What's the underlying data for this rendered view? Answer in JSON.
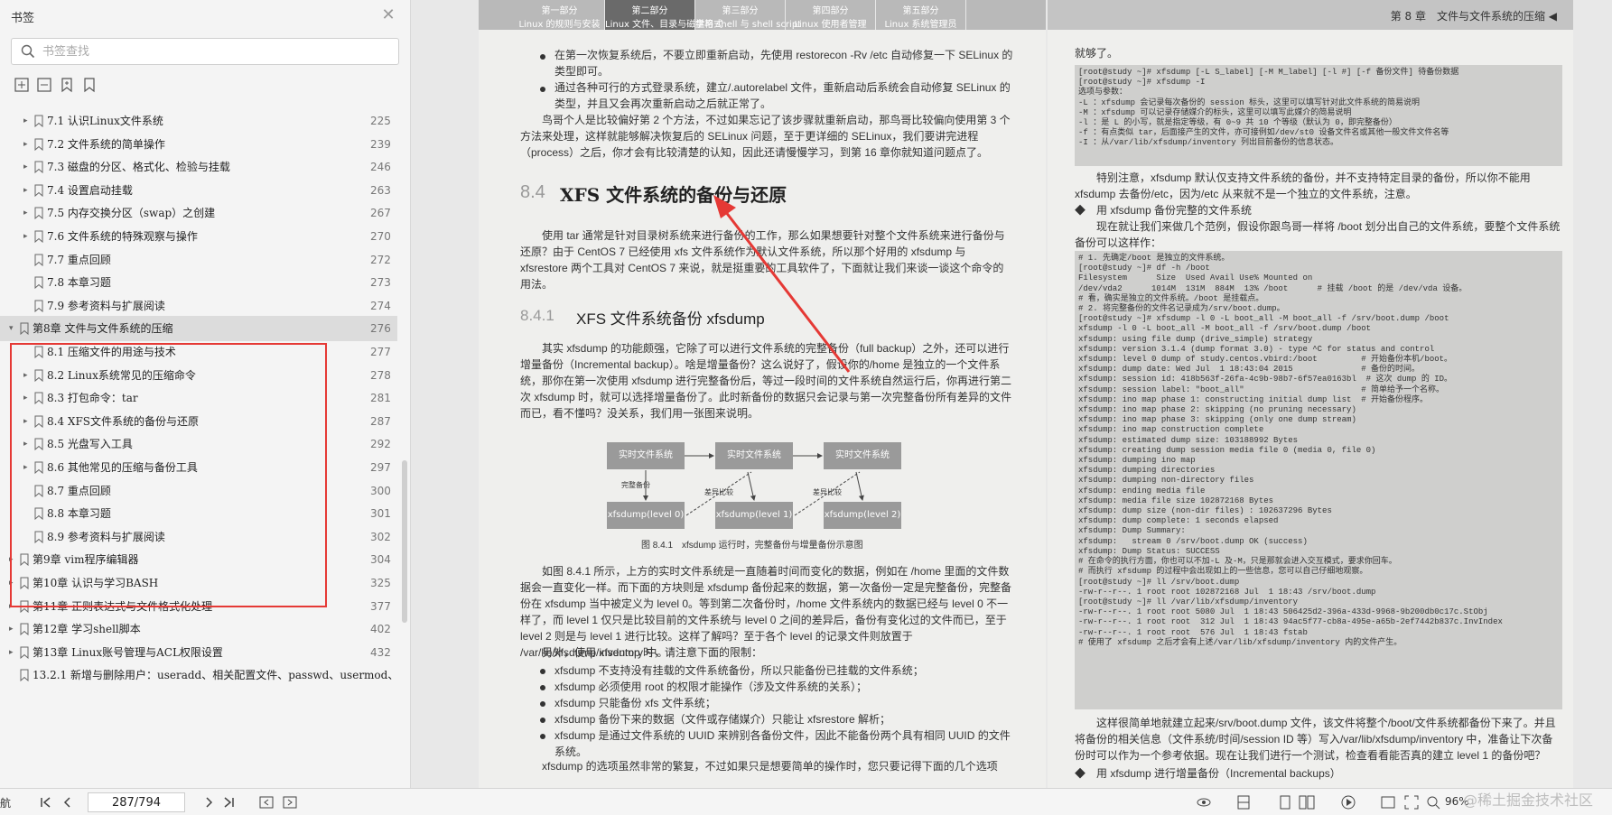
{
  "sidebar": {
    "title": "书签",
    "search_placeholder": "书签查找",
    "close_glyph": "✕",
    "bookmarks": [
      {
        "label": "7.1 认识Linux文件系统",
        "page": "225",
        "level": 2,
        "expandable": true
      },
      {
        "label": "7.2 文件系统的简单操作",
        "page": "239",
        "level": 2,
        "expandable": true
      },
      {
        "label": "7.3 磁盘的分区、格式化、检验与挂载",
        "page": "246",
        "level": 2,
        "expandable": true
      },
      {
        "label": "7.4 设置启动挂载",
        "page": "263",
        "level": 2,
        "expandable": true
      },
      {
        "label": "7.5 内存交换分区（swap）之创建",
        "page": "267",
        "level": 2,
        "expandable": true
      },
      {
        "label": "7.6 文件系统的特殊观察与操作",
        "page": "270",
        "level": 2,
        "expandable": true
      },
      {
        "label": "7.7 重点回顾",
        "page": "272",
        "level": 2,
        "expandable": false
      },
      {
        "label": "7.8 本章习题",
        "page": "273",
        "level": 2,
        "expandable": false
      },
      {
        "label": "7.9 参考资料与扩展阅读",
        "page": "274",
        "level": 2,
        "expandable": false
      },
      {
        "label": "第8章 文件与文件系统的压缩",
        "page": "276",
        "level": 1,
        "expandable": true,
        "expanded": true
      },
      {
        "label": "8.1 压缩文件的用途与技术",
        "page": "277",
        "level": 2,
        "expandable": false
      },
      {
        "label": "8.2 Linux系统常见的压缩命令",
        "page": "278",
        "level": 2,
        "expandable": true
      },
      {
        "label": "8.3 打包命令：tar",
        "page": "281",
        "level": 2,
        "expandable": true
      },
      {
        "label": "8.4 XFS文件系统的备份与还原",
        "page": "287",
        "level": 2,
        "expandable": true
      },
      {
        "label": "8.5 光盘写入工具",
        "page": "292",
        "level": 2,
        "expandable": true
      },
      {
        "label": "8.6 其他常见的压缩与备份工具",
        "page": "297",
        "level": 2,
        "expandable": true
      },
      {
        "label": "8.7 重点回顾",
        "page": "300",
        "level": 2,
        "expandable": false
      },
      {
        "label": "8.8 本章习题",
        "page": "301",
        "level": 2,
        "expandable": false
      },
      {
        "label": "8.9 参考资料与扩展阅读",
        "page": "302",
        "level": 2,
        "expandable": false
      },
      {
        "label": "第9章 vim程序编辑器",
        "page": "304",
        "level": 1,
        "expandable": true
      },
      {
        "label": "第10章 认识与学习BASH",
        "page": "325",
        "level": 1,
        "expandable": true
      },
      {
        "label": "第11章 正则表达式与文件格式化处理",
        "page": "377",
        "level": 1,
        "expandable": true
      },
      {
        "label": "第12章 学习shell脚本",
        "page": "402",
        "level": 1,
        "expandable": true
      },
      {
        "label": "第13章 Linux账号管理与ACL权限设置",
        "page": "432",
        "level": 1,
        "expandable": true
      },
      {
        "label": "13.2.1 新增与删除用户：useradd、相关配置文件、passwd、usermod、",
        "page": "",
        "level": 1,
        "expandable": false
      }
    ]
  },
  "document": {
    "tabs": [
      {
        "line1": "第一部分",
        "line2": "Linux 的规则与安装",
        "active": false
      },
      {
        "line1": "第二部分",
        "line2": "Linux 文件、目录与磁盘格式",
        "active": true
      },
      {
        "line1": "第三部分",
        "line2": "学习 shell 与 shell script",
        "active": false
      },
      {
        "line1": "第四部分",
        "line2": "Linux 使用者管理",
        "active": false
      },
      {
        "line1": "第五部分",
        "line2": "Linux 系统管理员",
        "active": false
      }
    ],
    "chapter_header": "第 8 章　文件与文件系统的压缩 ◀",
    "left": {
      "bullets_top": [
        "在第一次恢复系统后，不要立即重新启动，先使用 restorecon -Rv /etc 自动修复一下 SELinux 的类型即可。",
        "通过各种可行的方式登录系统，建立/.autorelabel 文件，重新启动后系统会自动修复 SELinux 的类型，并且又会再次重新启动之后就正常了。"
      ],
      "para_intro": "鸟哥个人是比较偏好第 2 个方法，不过如果忘记了该步骤就重新启动，那鸟哥比较偏向使用第 3 个方法来处理，这样就能够解决恢复后的 SELinux 问题，至于更详细的 SELinux，我们要讲完进程（process）之后，你才会有比较清楚的认知，因此还请慢慢学习，到第 16 章你就知道问题点了。",
      "sec_num": "8.4",
      "sec_title": "XFS 文件系统的备份与还原",
      "para_sec": "使用 tar 通常是针对目录树系统来进行备份的工作，那么如果想要针对整个文件系统来进行备份与还原？由于 CentOS 7 已经使用 xfs 文件系统作为默认文件系统，所以那个好用的 xfsdump 与 xfsrestore 两个工具对 CentOS 7 来说，就是挺重要的工具软件了，下面就让我们来谈一谈这个命令的用法。",
      "sub_num": "8.4.1",
      "sub_title": "XFS 文件系统备份 xfsdump",
      "para_sub": "其实 xfsdump 的功能颇强，它除了可以进行文件系统的完整备份（full backup）之外，还可以进行增量备份（Incremental backup）。啥是增量备份？这么说好了，假设你的/home 是独立的一个文件系统，那你在第一次使用 xfsdump 进行完整备份后，等过一段时间的文件系统自然运行后，你再进行第二次 xfsdump 时，就可以选择增量备份了。此时新备份的数据只会记录与第一次完整备份所有差异的文件而已，看不懂吗？没关系，我们用一张图来说明。",
      "diagram": {
        "top_boxes": [
          "实时文件系统",
          "实时文件系统",
          "实时文件系统"
        ],
        "bottom_boxes": [
          "xfsdump(level 0)",
          "xfsdump(level 1)",
          "xfsdump(level 2)"
        ],
        "labels": [
          "完整备份",
          "差异比较",
          "差异比较"
        ],
        "caption": "图 8.4.1　xfsdump 运行时，完整备份与增量备份示意图"
      },
      "para_fig": "如图 8.4.1 所示，上方的实时文件系统是一直随着时间而变化的数据，例如在 /home 里面的文件数据会一直变化一样。而下面的方块则是 xfsdump 备份起来的数据，第一次备份一定是完整备份，完整备份在 xfsdump 当中被定义为 level 0。等到第二次备份时，/home 文件系统内的数据已经与 level 0 不一样了，而 level 1 仅只是比较目前的文件系统与 level 0 之间的差异后，备份有变化过的文件而已，至于 level 2 则是与 level 1 进行比较。这样了解吗？至于各个 level 的记录文件则放置于 /var/lib/xfsdump/inventory 中。",
      "para_limit": "另外，使用 xfsdump 时，请注意下面的限制：",
      "bullets_bottom": [
        "xfsdump 不支持没有挂载的文件系统备份，所以只能备份已挂载的文件系统；",
        "xfsdump 必须使用 root 的权限才能操作（涉及文件系统的关系）；",
        "xfsdump 只能备份 xfs 文件系统；",
        "xfsdump 备份下来的数据（文件或存储媒介）只能让 xfsrestore 解析；",
        "xfsdump 是通过文件系统的 UUID 来辨别各备份文件，因此不能备份两个具有相同 UUID 的文件系统。"
      ],
      "para_end": "xfsdump 的选项虽然非常的繁复，不过如果只是想要简单的操作时，您只要记得下面的几个选项"
    },
    "right": {
      "lead": "就够了。",
      "code1": "[root@study ~]# xfsdump [-L S_label] [-M M_label] [-l #] [-f 备份文件] 待备份数据\n[root@study ~]# xfsdump -I\n选项与参数：\n-L ：xfsdump 会记录每次备份的 session 标头，这里可以填写针对此文件系统的简易说明\n-M ：xfsdump 可以记录存储媒介的标头，这里可以填写此媒介的简易说明\n-l ：是 L 的小写，就是指定等级，有 0~9 共 10 个等级（默认为 0，即完整备份）\n-f ：有点类似 tar，后面接产生的文件，亦可接例如/dev/st0 设备文件名或其他一般文件文件名等\n-I ：从/var/lib/xfsdump/inventory 列出目前备份的信息状态。",
      "para1": "特别注意，xfsdump 默认仅支持文件系统的备份，并不支持特定目录的备份，所以你不能用 xfsdump 去备份/etc，因为/etc 从来就不是一个独立的文件系统，注意。",
      "dia1": "◆　用 xfsdump 备份完整的文件系统",
      "para2": "现在就让我们来做几个范例，假设你跟鸟哥一样将 /boot 划分出自己的文件系统，要整个文件系统备份可以这样作：",
      "code2": "# 1. 先确定/boot 是独立的文件系统。\n[root@study ~]# df -h /boot\nFilesystem      Size  Used Avail Use% Mounted on\n/dev/vda2      1014M  131M  884M  13% /boot      # 挂载 /boot 的是 /dev/vda 设备。\n# 看，确实是独立的文件系统。/boot 是挂载点。\n# 2. 将完整备份的文件名记录成为/srv/boot.dump。\n[root@study ~]# xfsdump -l 0 -L boot_all -M boot_all -f /srv/boot.dump /boot\nxfsdump -l 0 -L boot_all -M boot_all -f /srv/boot.dump /boot\nxfsdump: using file dump (drive_simple) strategy\nxfsdump: version 3.1.4 (dump format 3.0) - type ^C for status and control\nxfsdump: level 0 dump of study.centos.vbird:/boot         # 开始备份本机/boot。\nxfsdump: dump date: Wed Jul  1 18:43:04 2015              # 备份的时间。\nxfsdump: session id: 418b563f-26fa-4c9b-98b7-6f57ea0163bl  # 这次 dump 的 ID。\nxfsdump: session label: \"boot_all\"                        # 简单给予一个名称。\nxfsdump: ino map phase 1: constructing initial dump list  # 开始备份程序。\nxfsdump: ino map phase 2: skipping (no pruning necessary)\nxfsdump: ino map phase 3: skipping (only one dump stream)\nxfsdump: ino map construction complete\nxfsdump: estimated dump size: 103188992 Bytes\nxfsdump: creating dump session media file 0 (media 0, file 0)\nxfsdump: dumping ino map\nxfsdump: dumping directories\nxfsdump: dumping non-directory files\nxfsdump: ending media file\nxfsdump: media file size 102872168 Bytes\nxfsdump: dump size (non-dir files) : 102637296 Bytes\nxfsdump: dump complete: 1 seconds elapsed\nxfsdump: Dump Summary:\nxfsdump:   stream 0 /srv/boot.dump OK (success)\nxfsdump: Dump Status: SUCCESS\n# 在命令的执行方面，你也可以不加-L 及-M，只是那就会进入交互模式，要求你回车。\n# 而执行 xfsdump 的过程中会出现如上的一些信息，您可以自己仔细地观察。\n[root@study ~]# ll /srv/boot.dump\n-rw-r--r--. 1 root root 102872168 Jul  1 18:43 /srv/boot.dump\n[root@study ~]# ll /var/lib/xfsdump/inventory\n-rw-r--r--. 1 root root 5080 Jul  1 18:43 506425d2-396a-433d-9968-9b200db0c17c.StObj\n-rw-r--r--. 1 root root  312 Jul  1 18:43 94ac5f77-cb8a-495e-a65b-2ef7442b837c.InvIndex\n-rw-r--r--. 1 root root  576 Jul  1 18:43 fstab\n# 使用了 xfsdump 之后才会有上述/var/lib/xfsdump/inventory 内的文件产生。",
      "para3": "这样很简单地就建立起来/srv/boot.dump 文件，该文件将整个/boot/文件系统都备份下来了。并且将备份的相关信息（文件系统/时间/session ID 等）写入/var/lib/xfsdump/inventory 中，准备让下次备份时可以作为一个参考依据。现在让我们进行一个测试，检查看看能否真的建立 level 1 的备份吧？",
      "dia2": "◆　用 xfsdump 进行增量备份（Incremental backups）"
    }
  },
  "bottombar": {
    "nav_label": "航",
    "page_value": "287/794",
    "zoom": "96%"
  },
  "watermark": "@稀土掘金技术社区",
  "colors": {
    "accent": "#e53935",
    "tab_active": "#6a6a6a"
  }
}
